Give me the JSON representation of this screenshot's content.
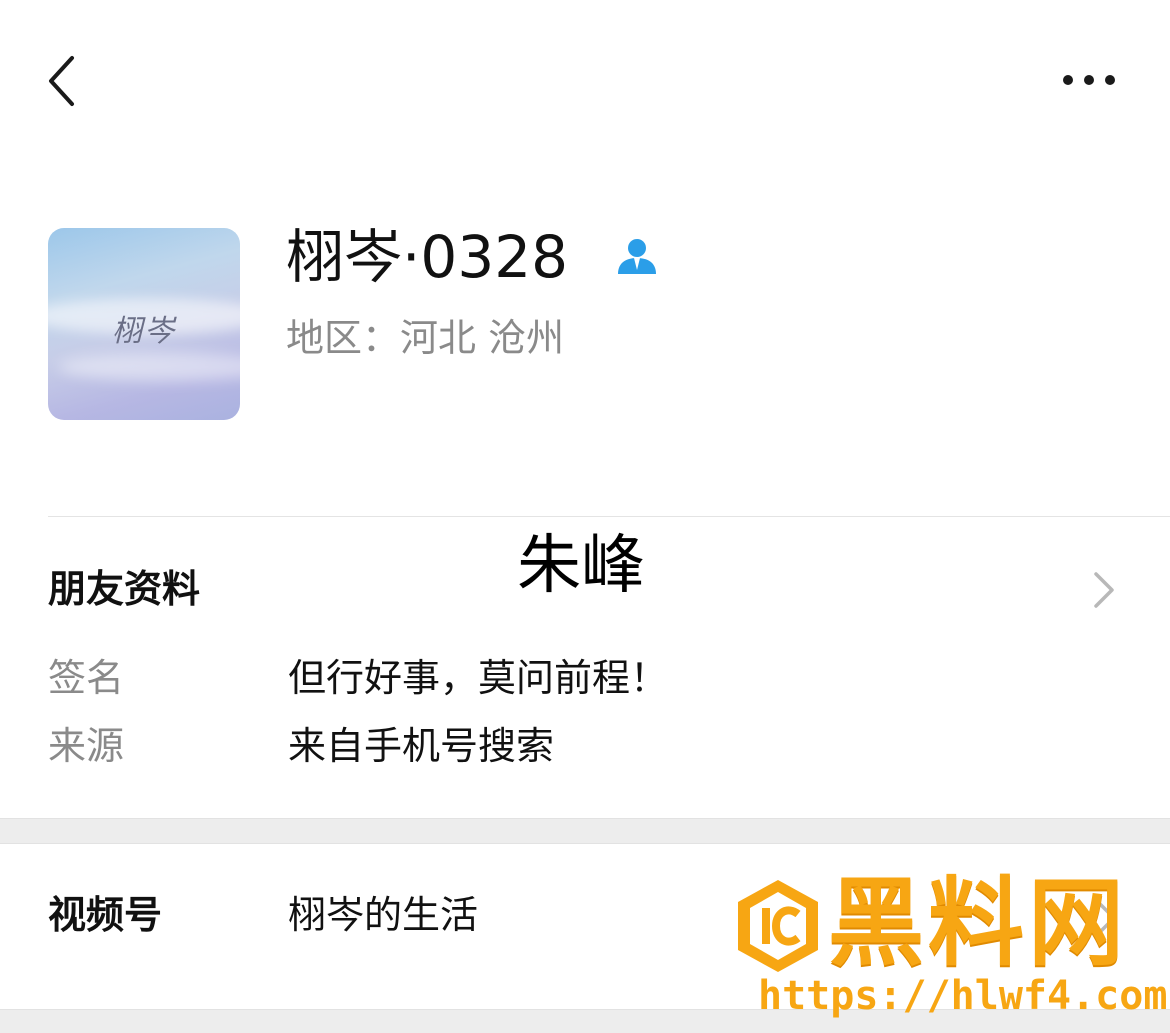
{
  "profile": {
    "avatar_text": "栩岑",
    "display_name": "栩岑·0328",
    "region": "地区：河北 沧州",
    "contact_icon": "person-icon"
  },
  "friend_info": {
    "section_title": "朋友资料",
    "remark_overlay": "朱峰",
    "rows": [
      {
        "label": "签名",
        "value": "但行好事，莫问前程！"
      },
      {
        "label": "来源",
        "value": "来自手机号搜索"
      }
    ]
  },
  "channels": {
    "label": "视频号",
    "value": "栩岑的生活"
  },
  "watermark": {
    "text": "黑料网",
    "url": "https://hlwf4.com"
  },
  "icons": {
    "back": "chevron-left-icon",
    "more": "more-dots-icon",
    "forward": "chevron-right-icon"
  },
  "colors": {
    "accent_blue": "#2b9ee8",
    "watermark_orange": "#f7a613"
  }
}
